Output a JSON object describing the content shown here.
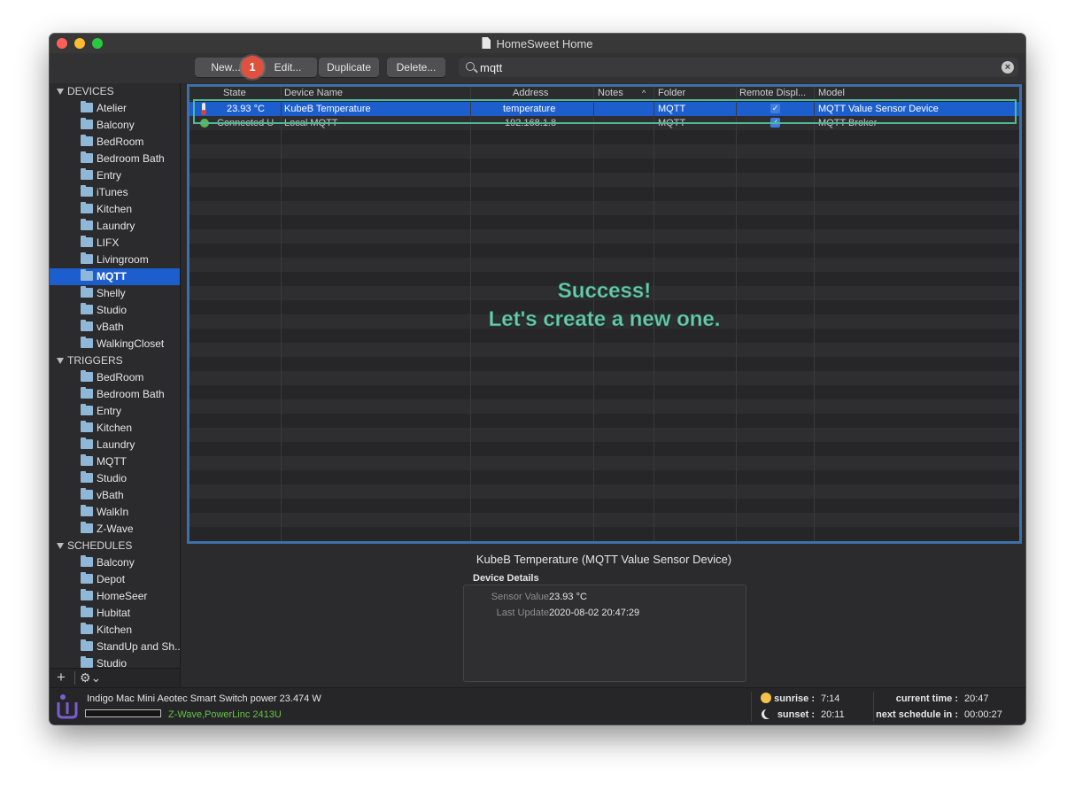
{
  "window": {
    "title": "HomeSweet Home"
  },
  "toolbar": {
    "new_label": "New...",
    "edit_label": "Edit...",
    "duplicate_label": "Duplicate",
    "delete_label": "Delete...",
    "search_value": "mqtt",
    "step_badge": "1"
  },
  "sidebar": {
    "devices_label": "DEVICES",
    "devices": [
      "Atelier",
      "Balcony",
      "BedRoom",
      "Bedroom Bath",
      "Entry",
      "iTunes",
      "Kitchen",
      "Laundry",
      "LIFX",
      "Livingroom",
      "MQTT",
      "Shelly",
      "Studio",
      "vBath",
      "WalkingCloset"
    ],
    "selected_device": "MQTT",
    "triggers_label": "TRIGGERS",
    "triggers": [
      "BedRoom",
      "Bedroom Bath",
      "Entry",
      "Kitchen",
      "Laundry",
      "MQTT",
      "Studio",
      "vBath",
      "WalkIn",
      "Z-Wave"
    ],
    "schedules_label": "SCHEDULES",
    "schedules": [
      "Balcony",
      "Depot",
      "HomeSeer",
      "Hubitat",
      "Kitchen",
      "StandUp and Sh...",
      "Studio"
    ]
  },
  "table": {
    "columns": {
      "state": "State",
      "name": "Device Name",
      "address": "Address",
      "notes": "Notes",
      "folder": "Folder",
      "remote": "Remote Displ...",
      "model": "Model"
    },
    "rows": [
      {
        "state": "23.93 °C",
        "name": "KubeB Temperature",
        "address": "temperature",
        "notes": "",
        "folder": "MQTT",
        "model": "MQTT Value Sensor Device"
      },
      {
        "state": "Connected U",
        "name": "Local MQTT",
        "address": "192.168.1.8",
        "notes": "",
        "folder": "MQTT",
        "model": "MQTT Broker"
      }
    ]
  },
  "overlay": {
    "line1": "Success!",
    "line2": "Let's create a new one."
  },
  "details": {
    "title": "KubeB Temperature (MQTT Value Sensor Device)",
    "header": "Device Details",
    "sensor_label": "Sensor Value",
    "sensor_value": "23.93 °C",
    "update_label": "Last Update",
    "update_value": "2020-08-02 20:47:29"
  },
  "status": {
    "message": "Indigo Mac Mini Aeotec Smart Switch power 23.474 W",
    "interface_zwave": "Z-Wave,",
    "interface_powerlinc": "PowerLinc 2413U",
    "sunrise_label": "sunrise :",
    "sunrise_value": "7:14",
    "sunset_label": "sunset :",
    "sunset_value": "20:11",
    "current_label": "current time :",
    "current_value": "20:47",
    "next_label": "next schedule in :",
    "next_value": "00:00:27"
  },
  "colors": {
    "selection": "#1d5ecf",
    "annotation": "#4fb79a",
    "badge": "#e0503e",
    "interface_green": "#63c442"
  }
}
